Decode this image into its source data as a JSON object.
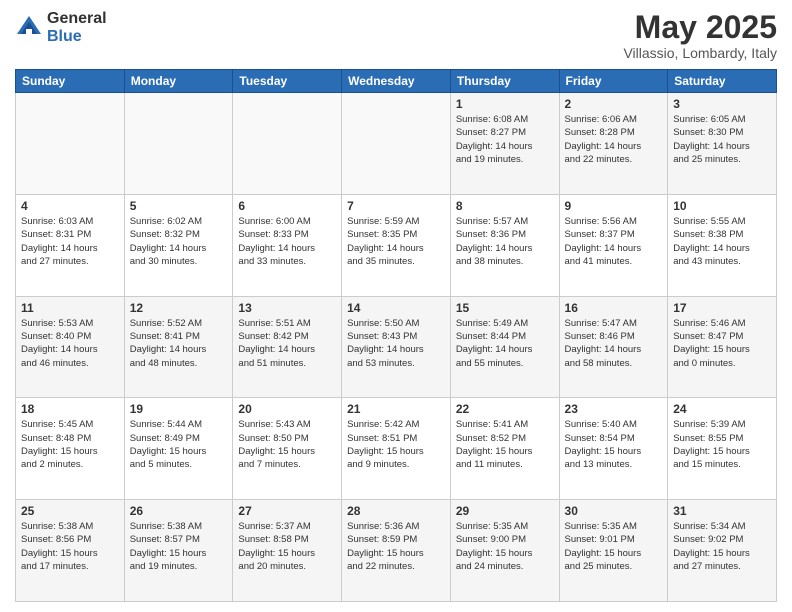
{
  "header": {
    "logo_general": "General",
    "logo_blue": "Blue",
    "month_title": "May 2025",
    "subtitle": "Villassio, Lombardy, Italy"
  },
  "weekdays": [
    "Sunday",
    "Monday",
    "Tuesday",
    "Wednesday",
    "Thursday",
    "Friday",
    "Saturday"
  ],
  "weeks": [
    [
      {
        "day": "",
        "info": "",
        "empty": true
      },
      {
        "day": "",
        "info": "",
        "empty": true
      },
      {
        "day": "",
        "info": "",
        "empty": true
      },
      {
        "day": "",
        "info": "",
        "empty": true
      },
      {
        "day": "1",
        "info": "Sunrise: 6:08 AM\nSunset: 8:27 PM\nDaylight: 14 hours\nand 19 minutes.",
        "empty": false
      },
      {
        "day": "2",
        "info": "Sunrise: 6:06 AM\nSunset: 8:28 PM\nDaylight: 14 hours\nand 22 minutes.",
        "empty": false
      },
      {
        "day": "3",
        "info": "Sunrise: 6:05 AM\nSunset: 8:30 PM\nDaylight: 14 hours\nand 25 minutes.",
        "empty": false
      }
    ],
    [
      {
        "day": "4",
        "info": "Sunrise: 6:03 AM\nSunset: 8:31 PM\nDaylight: 14 hours\nand 27 minutes.",
        "empty": false
      },
      {
        "day": "5",
        "info": "Sunrise: 6:02 AM\nSunset: 8:32 PM\nDaylight: 14 hours\nand 30 minutes.",
        "empty": false
      },
      {
        "day": "6",
        "info": "Sunrise: 6:00 AM\nSunset: 8:33 PM\nDaylight: 14 hours\nand 33 minutes.",
        "empty": false
      },
      {
        "day": "7",
        "info": "Sunrise: 5:59 AM\nSunset: 8:35 PM\nDaylight: 14 hours\nand 35 minutes.",
        "empty": false
      },
      {
        "day": "8",
        "info": "Sunrise: 5:57 AM\nSunset: 8:36 PM\nDaylight: 14 hours\nand 38 minutes.",
        "empty": false
      },
      {
        "day": "9",
        "info": "Sunrise: 5:56 AM\nSunset: 8:37 PM\nDaylight: 14 hours\nand 41 minutes.",
        "empty": false
      },
      {
        "day": "10",
        "info": "Sunrise: 5:55 AM\nSunset: 8:38 PM\nDaylight: 14 hours\nand 43 minutes.",
        "empty": false
      }
    ],
    [
      {
        "day": "11",
        "info": "Sunrise: 5:53 AM\nSunset: 8:40 PM\nDaylight: 14 hours\nand 46 minutes.",
        "empty": false
      },
      {
        "day": "12",
        "info": "Sunrise: 5:52 AM\nSunset: 8:41 PM\nDaylight: 14 hours\nand 48 minutes.",
        "empty": false
      },
      {
        "day": "13",
        "info": "Sunrise: 5:51 AM\nSunset: 8:42 PM\nDaylight: 14 hours\nand 51 minutes.",
        "empty": false
      },
      {
        "day": "14",
        "info": "Sunrise: 5:50 AM\nSunset: 8:43 PM\nDaylight: 14 hours\nand 53 minutes.",
        "empty": false
      },
      {
        "day": "15",
        "info": "Sunrise: 5:49 AM\nSunset: 8:44 PM\nDaylight: 14 hours\nand 55 minutes.",
        "empty": false
      },
      {
        "day": "16",
        "info": "Sunrise: 5:47 AM\nSunset: 8:46 PM\nDaylight: 14 hours\nand 58 minutes.",
        "empty": false
      },
      {
        "day": "17",
        "info": "Sunrise: 5:46 AM\nSunset: 8:47 PM\nDaylight: 15 hours\nand 0 minutes.",
        "empty": false
      }
    ],
    [
      {
        "day": "18",
        "info": "Sunrise: 5:45 AM\nSunset: 8:48 PM\nDaylight: 15 hours\nand 2 minutes.",
        "empty": false
      },
      {
        "day": "19",
        "info": "Sunrise: 5:44 AM\nSunset: 8:49 PM\nDaylight: 15 hours\nand 5 minutes.",
        "empty": false
      },
      {
        "day": "20",
        "info": "Sunrise: 5:43 AM\nSunset: 8:50 PM\nDaylight: 15 hours\nand 7 minutes.",
        "empty": false
      },
      {
        "day": "21",
        "info": "Sunrise: 5:42 AM\nSunset: 8:51 PM\nDaylight: 15 hours\nand 9 minutes.",
        "empty": false
      },
      {
        "day": "22",
        "info": "Sunrise: 5:41 AM\nSunset: 8:52 PM\nDaylight: 15 hours\nand 11 minutes.",
        "empty": false
      },
      {
        "day": "23",
        "info": "Sunrise: 5:40 AM\nSunset: 8:54 PM\nDaylight: 15 hours\nand 13 minutes.",
        "empty": false
      },
      {
        "day": "24",
        "info": "Sunrise: 5:39 AM\nSunset: 8:55 PM\nDaylight: 15 hours\nand 15 minutes.",
        "empty": false
      }
    ],
    [
      {
        "day": "25",
        "info": "Sunrise: 5:38 AM\nSunset: 8:56 PM\nDaylight: 15 hours\nand 17 minutes.",
        "empty": false
      },
      {
        "day": "26",
        "info": "Sunrise: 5:38 AM\nSunset: 8:57 PM\nDaylight: 15 hours\nand 19 minutes.",
        "empty": false
      },
      {
        "day": "27",
        "info": "Sunrise: 5:37 AM\nSunset: 8:58 PM\nDaylight: 15 hours\nand 20 minutes.",
        "empty": false
      },
      {
        "day": "28",
        "info": "Sunrise: 5:36 AM\nSunset: 8:59 PM\nDaylight: 15 hours\nand 22 minutes.",
        "empty": false
      },
      {
        "day": "29",
        "info": "Sunrise: 5:35 AM\nSunset: 9:00 PM\nDaylight: 15 hours\nand 24 minutes.",
        "empty": false
      },
      {
        "day": "30",
        "info": "Sunrise: 5:35 AM\nSunset: 9:01 PM\nDaylight: 15 hours\nand 25 minutes.",
        "empty": false
      },
      {
        "day": "31",
        "info": "Sunrise: 5:34 AM\nSunset: 9:02 PM\nDaylight: 15 hours\nand 27 minutes.",
        "empty": false
      }
    ]
  ]
}
